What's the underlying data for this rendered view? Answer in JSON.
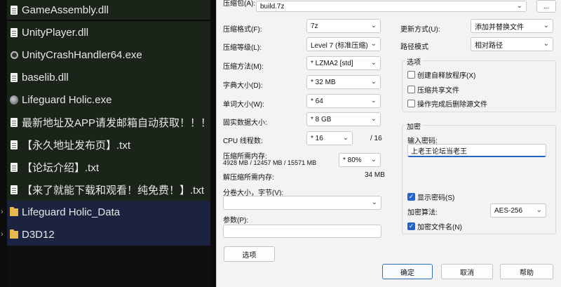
{
  "files": [
    {
      "name": "GameAssembly.dll",
      "icon": "dll-file-icon",
      "kind": "file"
    },
    {
      "name": "UnityPlayer.dll",
      "icon": "dll-file-icon",
      "kind": "file"
    },
    {
      "name": "UnityCrashHandler64.exe",
      "icon": "gear-icon",
      "kind": "file"
    },
    {
      "name": "baselib.dll",
      "icon": "dll-file-icon",
      "kind": "file"
    },
    {
      "name": "Lifeguard Holic.exe",
      "icon": "app-icon",
      "kind": "file"
    },
    {
      "name": "最新地址及APP请发邮箱自动获取！！！.txt",
      "icon": "text-file-icon",
      "kind": "file"
    },
    {
      "name": "【永久地址发布页】.txt",
      "icon": "text-file-icon",
      "kind": "file"
    },
    {
      "name": "【论坛介绍】.txt",
      "icon": "text-file-icon",
      "kind": "file"
    },
    {
      "name": "【来了就能下载和观看！纯免费！】.txt",
      "icon": "text-file-icon",
      "kind": "file"
    },
    {
      "name": "Lifeguard Holic_Data",
      "icon": "folder-icon",
      "kind": "folder"
    },
    {
      "name": "D3D12",
      "icon": "folder-icon",
      "kind": "folder"
    }
  ],
  "dialog": {
    "archive_label": "压缩包(A):",
    "archive_value": "build.7z",
    "browse_label": "...",
    "format_label": "压缩格式(F):",
    "format_value": "7z",
    "level_label": "压缩等级(L):",
    "level_value": "Level 7 (标准压缩)",
    "method_label": "压缩方法(M):",
    "method_value": "* LZMA2 [std]",
    "dict_label": "字典大小(D):",
    "dict_value": "* 32 MB",
    "word_label": "单词大小(W):",
    "word_value": "* 64",
    "solid_label": "固实数据大小:",
    "solid_value": "* 8 GB",
    "threads_label": "CPU 线程数:",
    "threads_value": "* 16",
    "threads_max": "/ 16",
    "mem_comp_label": "压缩所需内存:",
    "mem_comp_value": "4928 MB / 12457 MB / 15571 MB",
    "mem_comp_pct": "* 80%",
    "mem_decomp_label": "解压缩所需内存:",
    "mem_decomp_value": "34 MB",
    "split_label": "分卷大小，字节(V):",
    "split_value": "",
    "params_label": "参数(P):",
    "params_value": "",
    "options_button": "选项",
    "update_label": "更新方式(U):",
    "update_value": "添加并替换文件",
    "path_label": "路径模式",
    "path_value": "相对路径",
    "options_group": "选项",
    "opt_sfx": "创建自释放程序(X)",
    "opt_shared": "压缩共享文件",
    "opt_delete": "操作完成后删除源文件",
    "encrypt_group": "加密",
    "password_label": "输入密码:",
    "password_value": "上老王论坛当老王",
    "show_password": "显示密码(S)",
    "enc_method_label": "加密算法:",
    "enc_method_value": "AES-256",
    "encrypt_names": "加密文件名(N)",
    "ok": "确定",
    "cancel": "取消",
    "help": "帮助"
  }
}
